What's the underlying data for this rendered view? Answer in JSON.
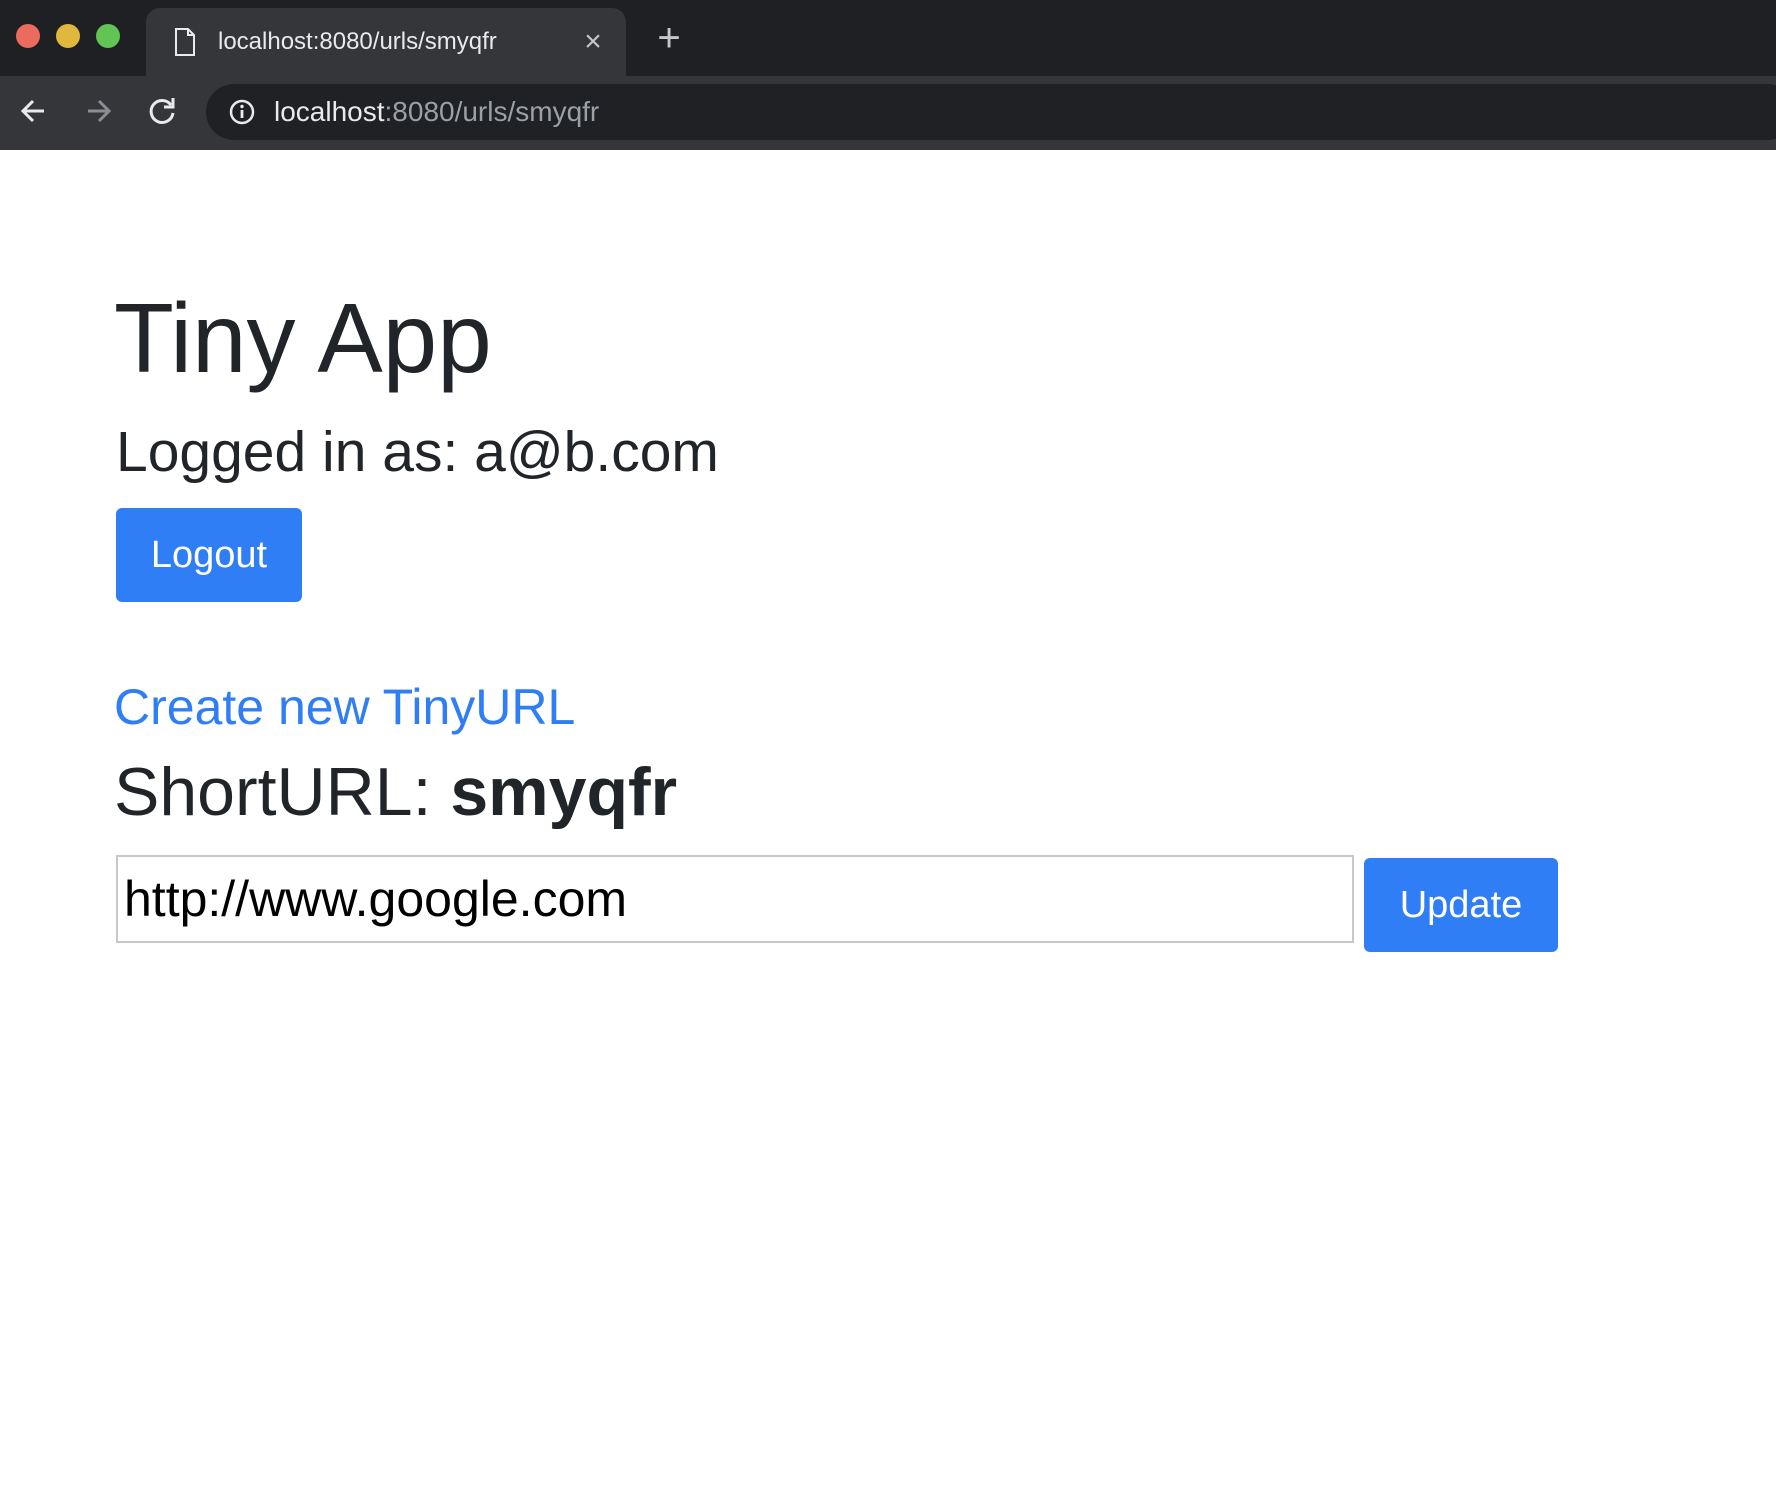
{
  "window": {
    "traffic_lights": {
      "close": "#ec6a5e",
      "minimize": "#e1b83e",
      "maximize": "#61c453"
    }
  },
  "browser": {
    "tab": {
      "title": "localhost:8080/urls/smyqfr",
      "favicon": "page-icon",
      "close_label": "×"
    },
    "new_tab_label": "+",
    "toolbar": {
      "back_icon": "arrow-left-icon",
      "forward_icon": "arrow-right-icon",
      "reload_icon": "reload-icon",
      "site_info_icon": "info-icon"
    },
    "address": {
      "host": "localhost",
      "rest": ":8080/urls/smyqfr"
    }
  },
  "page": {
    "heading": "Tiny App",
    "logged_in_label": "Logged in as: a@b.com",
    "logout_label": "Logout",
    "create_link_label": "Create new TinyURL",
    "shorturl_prefix": "ShortURL: ",
    "shorturl_code": "smyqfr",
    "long_url_value": "http://www.google.com",
    "update_label": "Update"
  },
  "colors": {
    "primary": "#2f7ef5",
    "text": "#212529",
    "chrome_dark": "#202124",
    "chrome_tab": "#35363a"
  }
}
